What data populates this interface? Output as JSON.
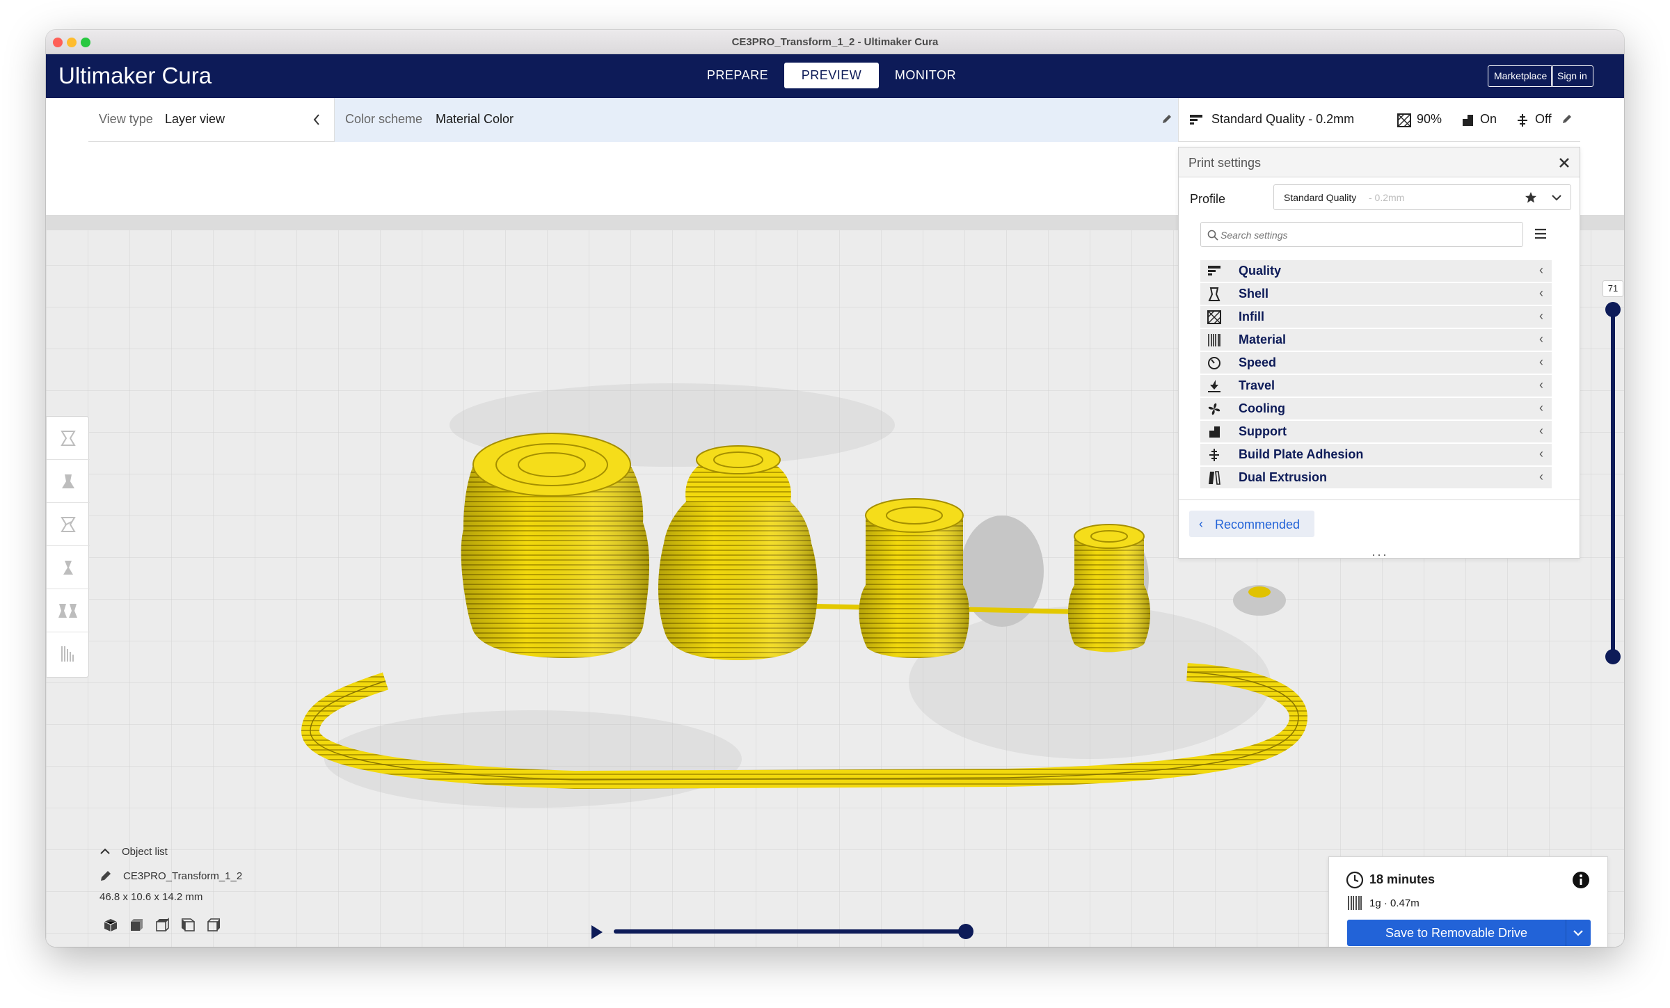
{
  "window": {
    "title": "CE3PRO_Transform_1_2 - Ultimaker Cura"
  },
  "header": {
    "logo_brand": "Ultimaker",
    "logo_product": "Cura",
    "stages": [
      "PREPARE",
      "PREVIEW",
      "MONITOR"
    ],
    "active_stage": "PREVIEW",
    "marketplace_label": "Marketplace",
    "signin_label": "Sign in"
  },
  "view_bar": {
    "view_type_label": "View type",
    "view_type_value": "Layer view",
    "color_scheme_label": "Color scheme",
    "color_scheme_value": "Material Color"
  },
  "print_setup": {
    "profile_summary": "Standard Quality - 0.2mm",
    "infill": "90%",
    "support": "On",
    "adhesion": "Off"
  },
  "print_settings": {
    "title": "Print settings",
    "profile_label": "Profile",
    "profile_name": "Standard Quality",
    "profile_suffix": "- 0.2mm",
    "search_placeholder": "Search settings",
    "categories": [
      "Quality",
      "Shell",
      "Infill",
      "Material",
      "Speed",
      "Travel",
      "Cooling",
      "Support",
      "Build Plate Adhesion",
      "Dual Extrusion"
    ],
    "recommended_label": "Recommended"
  },
  "layer_slider": {
    "current_layer": "71",
    "max_fraction": 1.0,
    "min_fraction": 0.0
  },
  "object_list": {
    "toggle_label": "Object list",
    "object_name": "CE3PRO_Transform_1_2",
    "dimensions": "46.8 x 10.6 x 14.2 mm"
  },
  "estimate": {
    "time": "18 minutes",
    "material": "1g · 0.47m",
    "save_label": "Save to Removable Drive"
  },
  "simulation": {
    "progress_fraction": 1.0
  },
  "colors": {
    "header_bg": "#0d1b58",
    "accent_blue": "#2263d8",
    "filament_yellow": "#f5d90a",
    "color_scheme_bg": "#e6eef9"
  },
  "icons": [
    "search-icon",
    "star-icon",
    "chevron-down-icon",
    "menu-icon",
    "close-icon",
    "pencil-icon",
    "clock-icon",
    "info-icon",
    "play-icon"
  ]
}
